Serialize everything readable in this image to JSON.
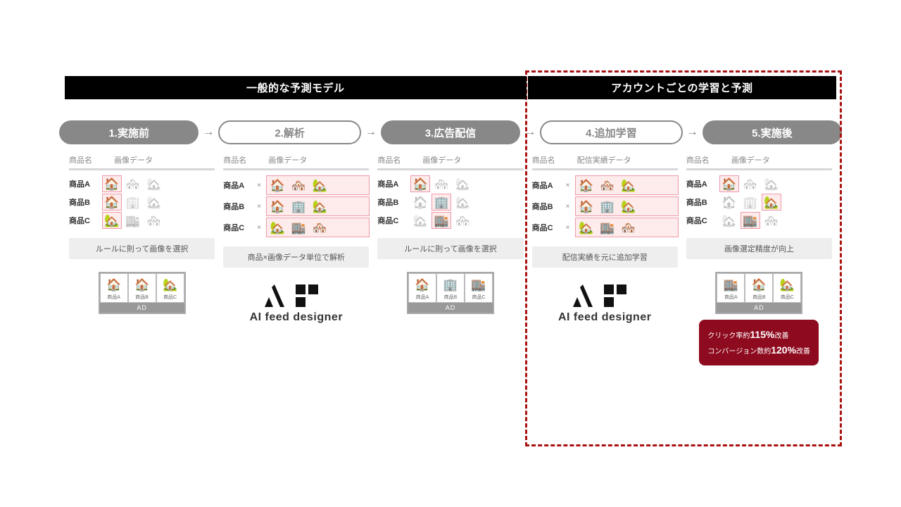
{
  "header_left": "一般的な予測モデル",
  "header_right": "アカウントごとの学習と予測",
  "steps": [
    "1.実施前",
    "2.解析",
    "3.広告配信",
    "4.追加学習",
    "5.実施後"
  ],
  "sub_name": "商品名",
  "sub_img": "画像データ",
  "sub_perf": "配信実績データ",
  "rows": [
    "商品A",
    "商品B",
    "商品C"
  ],
  "chips": [
    "ルールに則って画像を選択",
    "商品×画像データ単位で解析",
    "ルールに則って画像を選択",
    "配信実績を元に追加学習",
    "画像選定精度が向上"
  ],
  "logo_text": "AI feed designer",
  "ad_labels": [
    "商品A",
    "商品B",
    "商品C"
  ],
  "ad_foot": "AD",
  "result": {
    "l1a": "クリック率約",
    "l1b": "115%",
    "l1c": "改善",
    "l2a": "コンバージョン数約",
    "l2b": "120%",
    "l2c": "改善"
  }
}
